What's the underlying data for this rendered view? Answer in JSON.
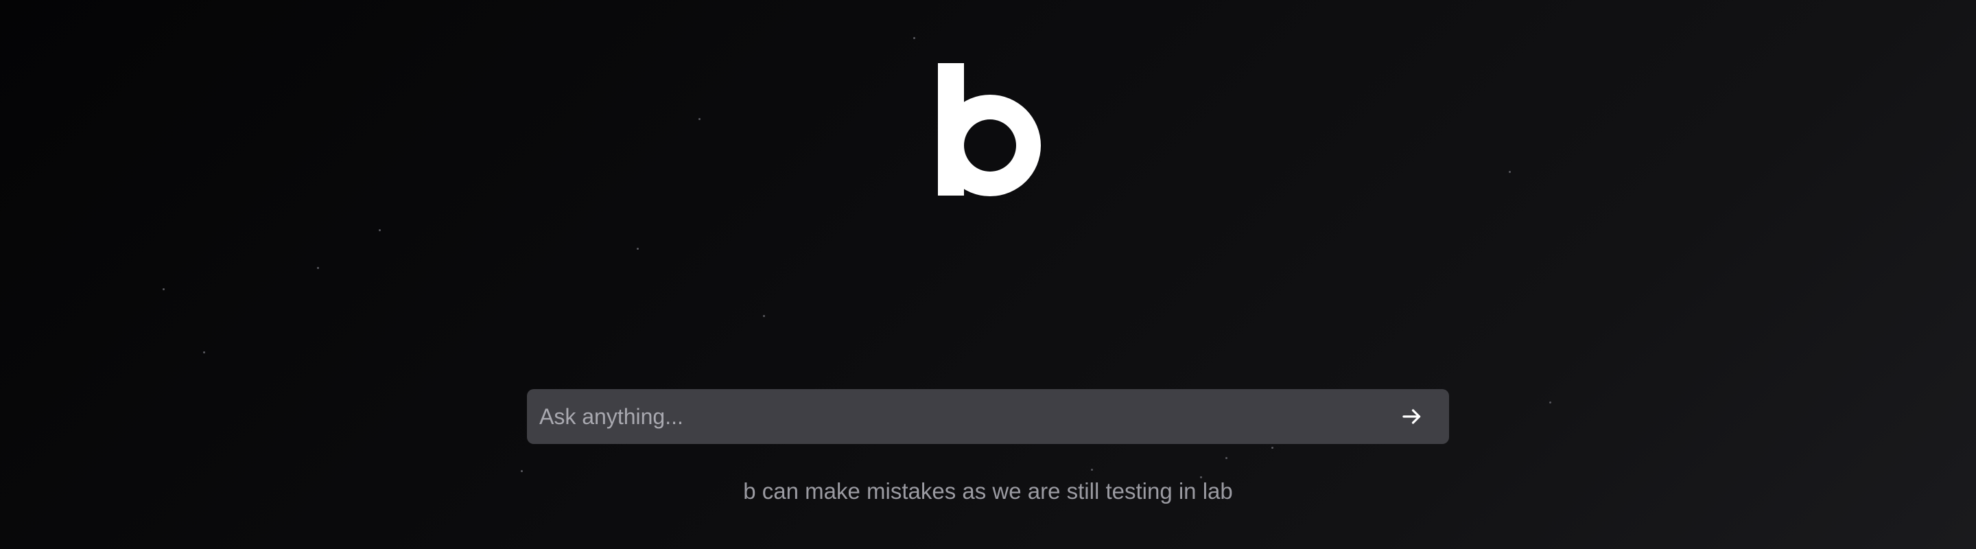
{
  "brand": {
    "logo_icon": "letter-b-logo",
    "logo_color": "#ffffff"
  },
  "search": {
    "placeholder": "Ask anything...",
    "value": "",
    "submit_icon": "arrow-right-icon"
  },
  "footer": {
    "disclaimer": "b can make mistakes as we are still testing in lab"
  },
  "colors": {
    "background": "#0b0b0d",
    "input_background": "#404045",
    "disclaimer_text": "#9b9ba2"
  }
}
